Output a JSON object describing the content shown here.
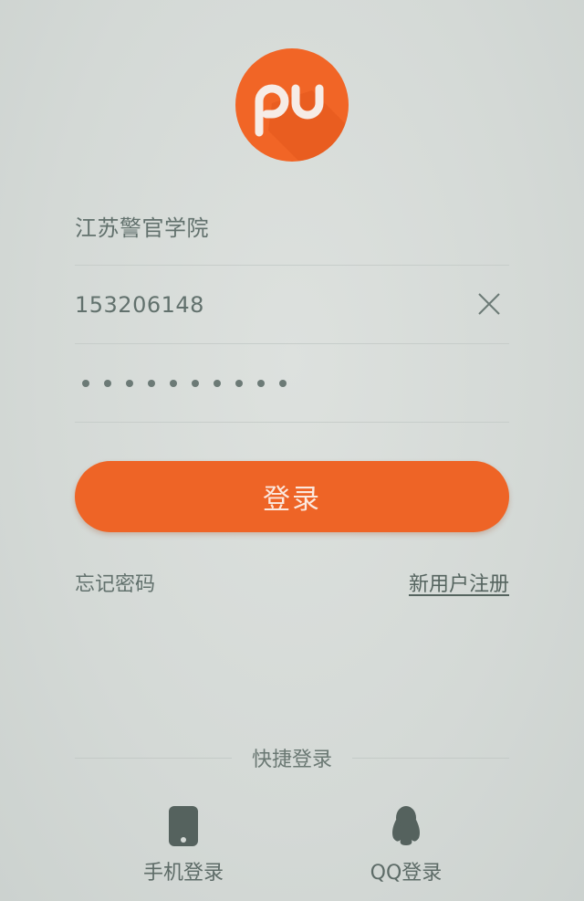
{
  "logo": {
    "text": "pu",
    "brand_color": "#f16526"
  },
  "form": {
    "school": "江苏警官学院",
    "account": "153206148",
    "password_masked": "••••••••••"
  },
  "login_button": {
    "label": "登录",
    "color": "#ee6426"
  },
  "links": {
    "forgot_password": "忘记密码",
    "register": "新用户注册"
  },
  "quick_login": {
    "title": "快捷登录",
    "phone_label": "手机登录",
    "qq_label": "QQ登录",
    "phone_icon": "phone-icon",
    "qq_icon": "qq-penguin-icon"
  },
  "icons": {
    "clear": "close-icon"
  }
}
